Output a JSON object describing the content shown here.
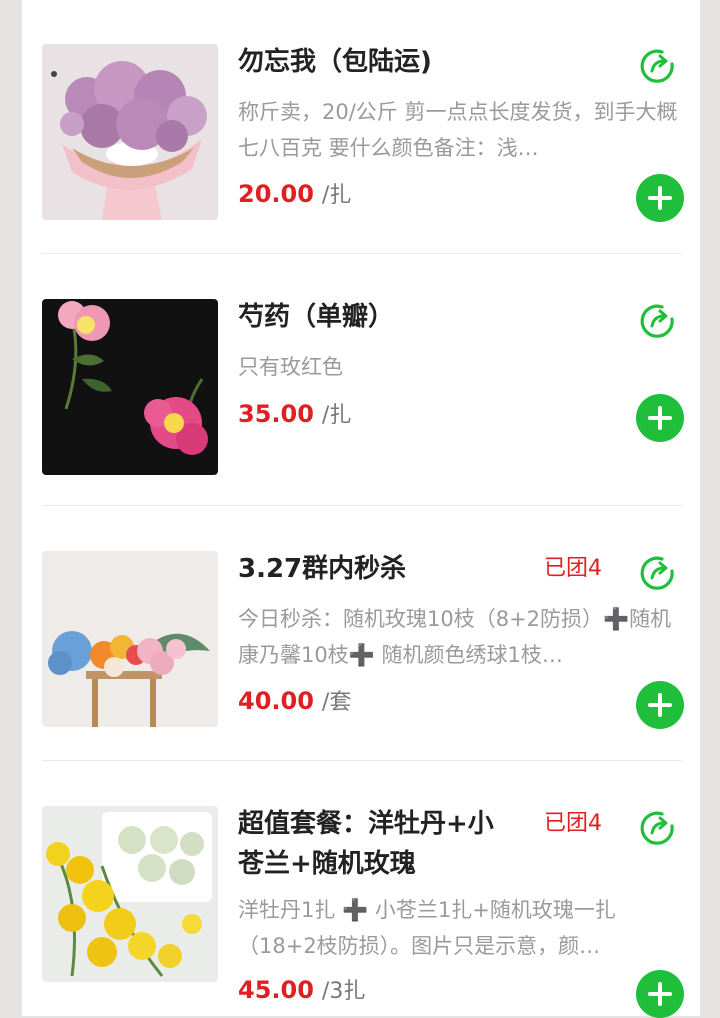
{
  "products": [
    {
      "title": "勿忘我（包陆运)",
      "badge": "",
      "desc": "称斤卖，20/公斤 剪一点点长度发货，到手大概七八百克 要什么颜色备注：浅…",
      "price": "20.00",
      "unit": "/扎"
    },
    {
      "title": "芍药（单瓣）",
      "badge": "",
      "desc": "只有玫红色",
      "price": "35.00",
      "unit": "/扎"
    },
    {
      "title": "3.27群内秒杀",
      "badge": "已团4",
      "desc": "今日秒杀：随机玫瑰10枝（8+2防损）➕随机康乃馨10枝➕ 随机颜色绣球1枝…",
      "price": "40.00",
      "unit": "/套"
    },
    {
      "title": "超值套餐：洋牡丹+小苍兰+随机玫瑰",
      "badge": "已团4",
      "desc": "洋牡丹1扎 ➕ 小苍兰1扎+随机玫瑰一扎（18+2枝防损）。图片只是示意，颜…",
      "price": "45.00",
      "unit": "/3扎"
    }
  ],
  "colors": {
    "price": "#e02020",
    "add_button": "#1fbf3c",
    "share_icon": "#1fbf3c"
  }
}
